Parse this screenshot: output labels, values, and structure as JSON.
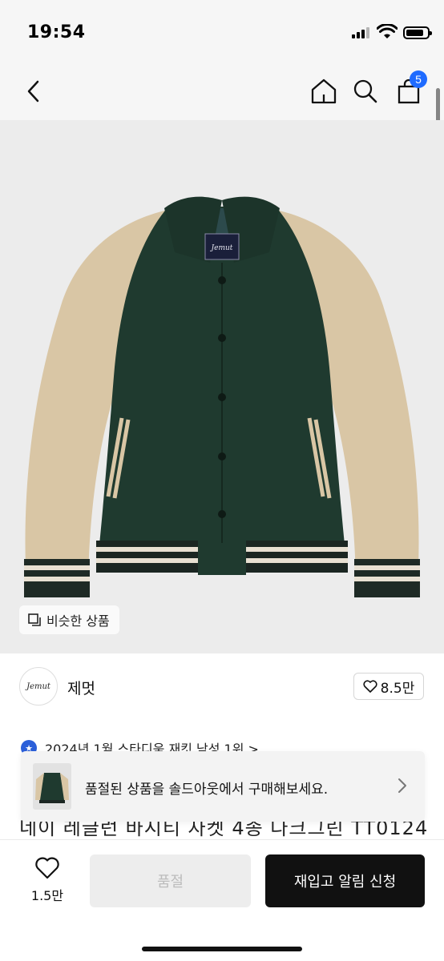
{
  "status_bar": {
    "time": "19:54",
    "signal_icon": "cellular-signal-icon",
    "wifi_icon": "wifi-icon",
    "battery_icon": "battery-icon",
    "battery_level": 0.85
  },
  "nav": {
    "back_icon": "chevron-left-icon",
    "home_icon": "home-icon",
    "search_icon": "search-icon",
    "cart_icon": "shopping-bag-icon",
    "cart_badge": "5",
    "badge_color": "#1f6bff"
  },
  "product_image": {
    "logo_text": "Jemut",
    "similar_icon": "similar-items-icon",
    "similar_label": "비슷한 상품"
  },
  "brand": {
    "logo_text": "Jemut",
    "name": "제멋",
    "like_icon": "heart-icon",
    "like_count": "8.5만"
  },
  "ranking": {
    "text": "2024년 1월 스타디움 재킷 남성 1위 >"
  },
  "product_title_peek": "네이 레글런 바시티 자켓 4종 다크그린 TT0124",
  "soldout_banner": {
    "text": "품절된 상품을 솔드아웃에서 구매해보세요.",
    "chevron_icon": "chevron-right-icon"
  },
  "bottom_bar": {
    "wish_icon": "heart-outline-icon",
    "wish_count": "1.5만",
    "soldout_label": "품절",
    "restock_label": "재입고 알림 신청"
  },
  "colors": {
    "jacket_body": "#1f3a2f",
    "jacket_sleeve": "#d9c6a5",
    "accent_blue": "#1f6bff"
  }
}
